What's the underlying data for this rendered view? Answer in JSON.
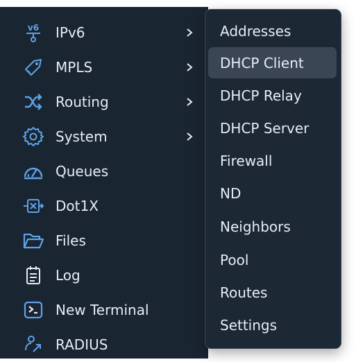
{
  "sidebar": {
    "items": [
      {
        "label": "IPv6",
        "icon": "ipv6-icon",
        "has_submenu": true
      },
      {
        "label": "MPLS",
        "icon": "tag-icon",
        "has_submenu": true
      },
      {
        "label": "Routing",
        "icon": "shuffle-icon",
        "has_submenu": true
      },
      {
        "label": "System",
        "icon": "gear-icon",
        "has_submenu": true
      },
      {
        "label": "Queues",
        "icon": "gauge-icon",
        "has_submenu": false
      },
      {
        "label": "Dot1X",
        "icon": "dot1x-icon",
        "has_submenu": false
      },
      {
        "label": "Files",
        "icon": "folder-icon",
        "has_submenu": false
      },
      {
        "label": "Log",
        "icon": "notepad-icon",
        "has_submenu": false
      },
      {
        "label": "New Terminal",
        "icon": "terminal-icon",
        "has_submenu": false
      },
      {
        "label": "RADIUS",
        "icon": "radius-icon",
        "has_submenu": false
      }
    ],
    "ipv6_icon_text": "v6"
  },
  "submenu": {
    "parent": "IPv6",
    "hovered": "DHCP Client",
    "items": [
      "Addresses",
      "DHCP Client",
      "DHCP Relay",
      "DHCP Server",
      "Firewall",
      "ND",
      "Neighbors",
      "Pool",
      "Routes",
      "Settings"
    ]
  },
  "colors": {
    "sidebar_bg": "#1a2532",
    "submenu_bg": "#1d2835",
    "submenu_border": "#394656",
    "hover_bg": "#3a4654",
    "text": "#e6edf5",
    "icon_accent": "#5ea3e8"
  }
}
